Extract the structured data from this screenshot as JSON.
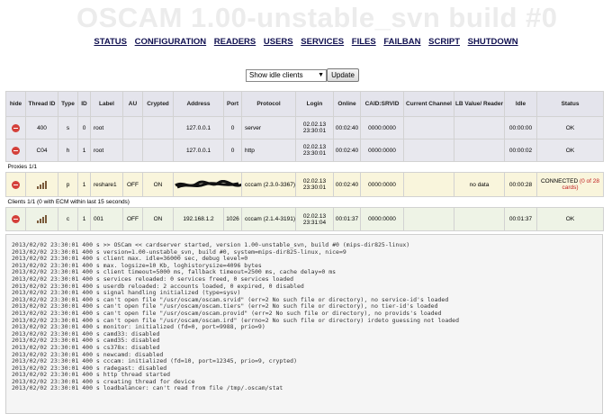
{
  "banner": "OSCAM 1.00-unstable_svn build #0",
  "menu": [
    "STATUS",
    "CONFIGURATION",
    "READERS",
    "USERS",
    "SERVICES",
    "FILES",
    "FAILBAN",
    "SCRIPT",
    "SHUTDOWN"
  ],
  "filter": {
    "selected": "Show idle clients",
    "button": "Update"
  },
  "headers": [
    "hide",
    "Thread ID",
    "Type",
    "ID",
    "Label",
    "AU",
    "Crypted",
    "Address",
    "Port",
    "Protocol",
    "Login",
    "Online",
    "CAID:SRVID",
    "Current Channel",
    "LB Value/ Reader",
    "Idle",
    "Status"
  ],
  "server_rows": [
    {
      "thread": "400",
      "type": "s",
      "id": "0",
      "label": "root",
      "au": "",
      "crypted": "",
      "address": "127.0.0.1",
      "port": "0",
      "protocol": "server",
      "login": "02.02.13 23:30:01",
      "online": "00:02:40",
      "caid": "0000:0000",
      "channel": "",
      "lb": "",
      "idle": "00:00:00",
      "status": "OK"
    },
    {
      "thread": "C04",
      "type": "h",
      "id": "1",
      "label": "root",
      "au": "",
      "crypted": "",
      "address": "127.0.0.1",
      "port": "0",
      "protocol": "http",
      "login": "02.02.13 23:30:01",
      "online": "00:02:40",
      "caid": "0000:0000",
      "channel": "",
      "lb": "",
      "idle": "00:00:02",
      "status": "OK"
    }
  ],
  "proxies_label": "Proxies 1/1",
  "proxy_row": {
    "type": "p",
    "id": "1",
    "label": "reshare1",
    "au": "OFF",
    "crypted": "ON",
    "port": "",
    "protocol": "cccam (2.3.0-3367)",
    "login": "02.02.13 23:30:01",
    "online": "00:02:40",
    "caid": "0000:0000",
    "channel": "",
    "lb": "no data",
    "idle": "00:00:28",
    "status": "CONNECTED",
    "status_extra": "(0 of 28 cards)"
  },
  "clients_label": "Clients 1/1 (0 with ECM within last 15 seconds)",
  "client_row": {
    "type": "c",
    "id": "1",
    "label": "001",
    "au": "OFF",
    "crypted": "ON",
    "address": "192.168.1.2",
    "port": "1026",
    "protocol": "cccam (2.1.4-3191)",
    "login": "02.02.13 23:31:04",
    "online": "00:01:37",
    "caid": "0000:0000",
    "channel": "",
    "lb": "",
    "idle": "00:01:37",
    "status": "OK"
  },
  "log": [
    "2013/02/02 23:30:01 400 s >> OSCam << cardserver started, version 1.00-unstable_svn, build #0 (mips-dir825-linux)",
    "2013/02/02 23:30:01 400 s version=1.00-unstable_svn, build #0, system=mips-dir825-linux, nice=9",
    "2013/02/02 23:30:01 400 s client max. idle=36000 sec, debug level=0",
    "2013/02/02 23:30:01 400 s max. logsize=10 Kb, loghistorysize=4096 bytes",
    "2013/02/02 23:30:01 400 s client timeout=5000 ms, fallback timeout=2500 ms, cache delay=0 ms",
    "2013/02/02 23:30:01 400 s services reloaded: 0 services freed, 0 services loaded",
    "2013/02/02 23:30:01 400 s userdb reloaded: 2 accounts loaded, 0 expired, 0 disabled",
    "2013/02/02 23:30:01 400 s signal handling initialized (type=sysv)",
    "2013/02/02 23:30:01 400 s can't open file \"/usr/oscam/oscam.srvid\" (err=2 No such file or directory), no service-id's loaded",
    "2013/02/02 23:30:01 400 s can't open file \"/usr/oscam/oscam.tiers\" (err=2 No such file or directory), no tier-id's loaded",
    "2013/02/02 23:30:01 400 s can't open file \"/usr/oscam/oscam.provid\" (err=2 No such file or directory), no provids's loaded",
    "2013/02/02 23:30:01 400 s can't open file \"/usr/oscam/oscam.ird\" (errno=2 No such file or directory) irdeto guessing not loaded",
    "2013/02/02 23:30:01 400 s monitor: initialized (fd=0, port=9988, prio=9)",
    "2013/02/02 23:30:01 400 s camd33: disabled",
    "2013/02/02 23:30:01 400 s camd35: disabled",
    "2013/02/02 23:30:01 400 s cs378x: disabled",
    "2013/02/02 23:30:01 400 s newcamd: disabled",
    "2013/02/02 23:30:01 400 s cccam: initialized (fd=10, port=12345, prio=9, crypted)",
    "2013/02/02 23:30:01 400 s radegast: disabled",
    "2013/02/02 23:30:01 400 s http thread started",
    "2013/02/02 23:30:01 400 s creating thread for device",
    "2013/02/02 23:30:01 400 s loadbalancer: can't read from file /tmp/.oscam/stat"
  ]
}
